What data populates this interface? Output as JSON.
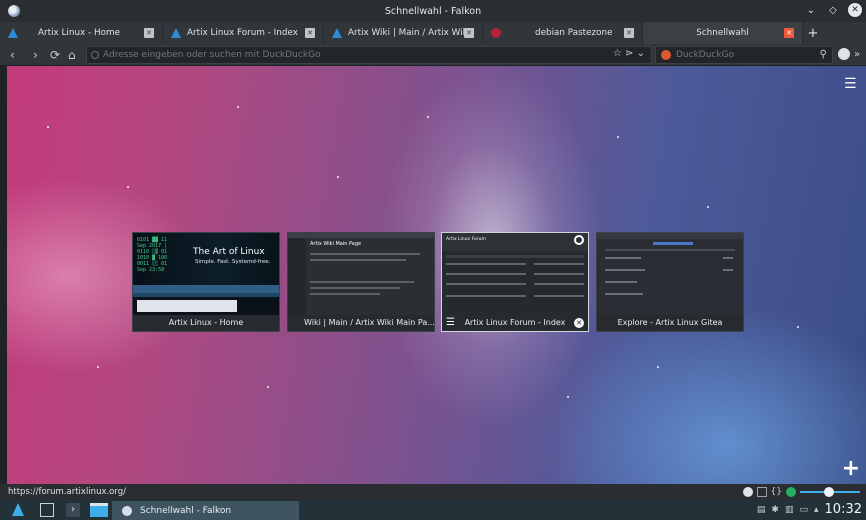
{
  "window": {
    "title": "Schnellwahl - Falkon"
  },
  "tabs": [
    {
      "label": "Artix Linux - Home",
      "favicon": "artix-icon"
    },
    {
      "label": "Artix Linux Forum - Index",
      "favicon": "artix-icon"
    },
    {
      "label": "Artix Wiki | Main / Artix Wik...",
      "favicon": "artix-icon"
    },
    {
      "label": "debian Pastezone",
      "favicon": "debian-icon"
    },
    {
      "label": "Schnellwahl",
      "favicon": "none",
      "active": true
    }
  ],
  "navbar": {
    "url_placeholder": "Adresse eingeben oder suchen mit DuckDuckGo",
    "search_placeholder": "DuckDuckGo"
  },
  "speed_dial": {
    "items": [
      {
        "title": "Artix Linux - Home",
        "hero_line1": "The Art of Linux",
        "hero_line2": "Simple. Fast. Systemd-free."
      },
      {
        "title": "Wiki | Main / Artix Wiki Main Pa...",
        "page_heading": "Artix Wiki Main Page"
      },
      {
        "title": "Artix Linux Forum - Index",
        "page_heading": "Artix Linux Forum"
      },
      {
        "title": "Explore - Artix Linux Gitea"
      }
    ]
  },
  "status": {
    "hover_url": "https://forum.artixlinux.org/"
  },
  "taskbar": {
    "active_task": "Schnellwahl - Falkon",
    "clock": "10:32"
  },
  "colors": {
    "accent": "#3daee9",
    "tab_close_active": "#f05a3c"
  }
}
